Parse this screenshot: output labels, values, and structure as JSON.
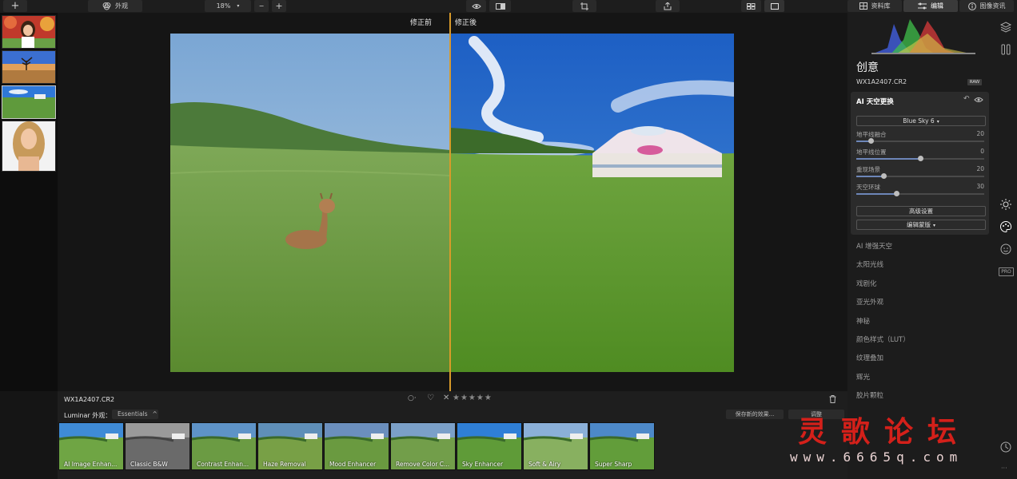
{
  "toolbar": {
    "add_label": "+",
    "looks_label": "外观",
    "zoom_value": "18%",
    "zoom_minus": "−",
    "zoom_plus": "+",
    "library_label": "资料库",
    "edit_label": "编辑",
    "info_label": "图像资讯"
  },
  "compare": {
    "before_label": "修正前",
    "after_label": "修正後"
  },
  "bottom": {
    "filename": "WX1A2407.CR2",
    "looks_title": "Luminar 外观：",
    "looks_category": "Essentials",
    "save_look_label": "保存新的效果...",
    "adjust_label": "调整",
    "stars": "★★★★★",
    "presets": [
      {
        "label": "AI Image Enhan..."
      },
      {
        "label": "Classic B&W"
      },
      {
        "label": "Contrast Enhan..."
      },
      {
        "label": "Haze Removal"
      },
      {
        "label": "Mood Enhancer"
      },
      {
        "label": "Remove Color C..."
      },
      {
        "label": "Sky Enhancer"
      },
      {
        "label": "Soft & Airy"
      },
      {
        "label": "Super Sharp"
      }
    ]
  },
  "panel": {
    "section_title": "创意",
    "filename": "WX1A2407.CR2",
    "raw_badge": "RAW",
    "tool_title": "AI 天空更换",
    "sky_select": "Blue Sky 6",
    "sliders": [
      {
        "name": "地平线融合",
        "value": "20",
        "level": 0.11
      },
      {
        "name": "地平线位置",
        "value": "0",
        "level": 0.5
      },
      {
        "name": "重现场景",
        "value": "20",
        "level": 0.21
      },
      {
        "name": "天空环球",
        "value": "30",
        "level": 0.31
      }
    ],
    "advanced_label": "高级设置",
    "mask_label": "编辑蒙版",
    "tools": [
      "AI 增强天空",
      "太阳光线",
      "戏剧化",
      "亚光外观",
      "神秘",
      "颜色样式（LUT）",
      "纹理叠加",
      "辉光",
      "胶片颗粒"
    ],
    "pro_badge": "PRO"
  },
  "watermark": {
    "title": "灵歌论坛",
    "url": "www.6665q.com"
  },
  "colors": {
    "accent": "#d89a2a",
    "panel_bg": "#1c1c1c",
    "watermark": "#d4201a"
  }
}
